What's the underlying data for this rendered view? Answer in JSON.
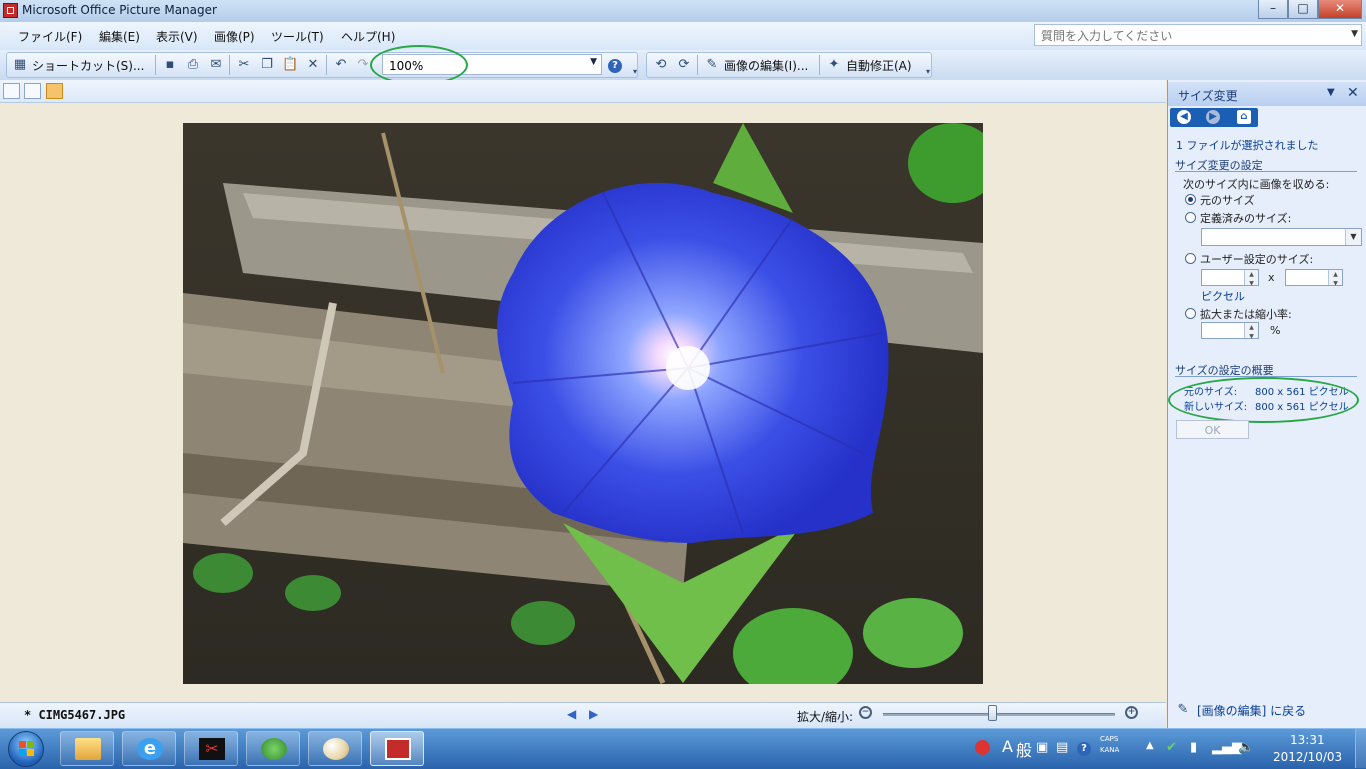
{
  "window": {
    "title": "Microsoft Office Picture Manager",
    "minimize": "–",
    "maximize": "□",
    "close": "✕"
  },
  "menu": {
    "items": [
      "ファイル(F)",
      "編集(E)",
      "表示(V)",
      "画像(P)",
      "ツール(T)",
      "ヘルプ(H)"
    ],
    "help_placeholder": "質問を入力してください"
  },
  "toolbar": {
    "shortcut_label": "ショートカット(S)...",
    "zoom_value": "100%",
    "edit_picture_label": "画像の編集(I)...",
    "autocorrect_label": "自動修正(A)"
  },
  "status": {
    "filename": "* CIMG5467.JPG",
    "zoom_label": "拡大/縮小:",
    "zoom_percent": 47
  },
  "pane": {
    "title": "サイズ変更",
    "selected_files": "1 ファイルが選択されました",
    "settings_heading": "サイズ変更の設定",
    "fit_instruction": "次のサイズ内に画像を収める:",
    "option_original": "元のサイズ",
    "option_predefined": "定義済みのサイズ:",
    "option_custom": "ユーザー設定のサイズ:",
    "custom_x": "x",
    "pixels_label": "ピクセル",
    "option_percent": "拡大または縮小率:",
    "percent_sign": "%",
    "summary_heading": "サイズの設定の概要",
    "original_size_label": "元のサイズ:",
    "original_size_value": "800 x 561 ピクセル",
    "new_size_label": "新しいサイズ:",
    "new_size_value": "800 x 561 ピクセル",
    "ok_label": "OK",
    "back_link": "[画像の編集] に戻る"
  },
  "taskbar": {
    "tray": {
      "ime_a": "A",
      "ime_mode": "般",
      "caps": "CAPS",
      "kana": "KANA",
      "time": "13:31",
      "date": "2012/10/03"
    }
  },
  "colors": {
    "highlight_ellipse": "#27a744",
    "pane_link": "#0b3f98",
    "taskbar": "#2a63ab"
  }
}
